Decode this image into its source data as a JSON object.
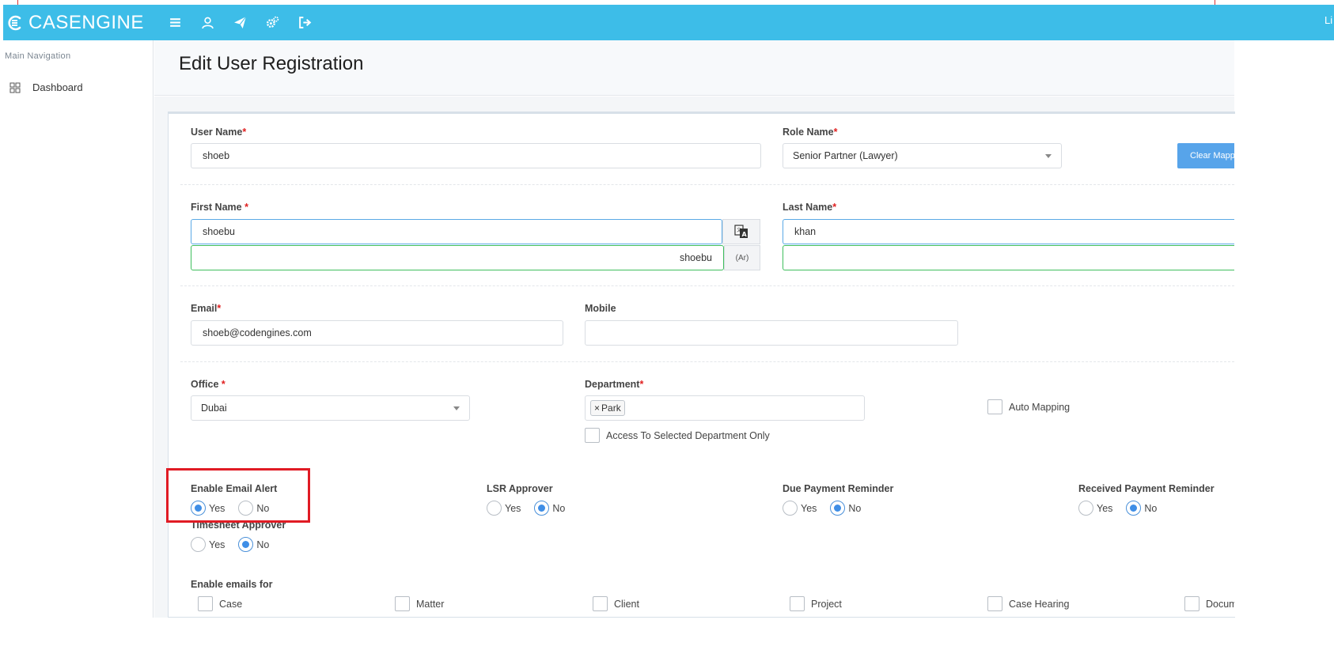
{
  "app": {
    "brand": "CASENGINE",
    "topbar_right_text": "Li"
  },
  "sidebar": {
    "heading": "Main Navigation",
    "items": [
      {
        "label": "Dashboard",
        "icon": "grid-icon"
      }
    ]
  },
  "page": {
    "title": "Edit User Registration"
  },
  "form": {
    "user_name": {
      "label": "User Name",
      "required": "*",
      "value": "shoeb"
    },
    "role_name": {
      "label": "Role Name",
      "required": "*",
      "value": "Senior Partner (Lawyer)"
    },
    "clear_mapping_label": "Clear Mapp",
    "first_name": {
      "label": "First Name ",
      "required": "*",
      "value": "shoebu",
      "value_ar": "shoebu",
      "ar_addon": "(Ar)"
    },
    "last_name": {
      "label": "Last Name",
      "required": "*",
      "value": "khan",
      "value_ar": ""
    },
    "email": {
      "label": "Email",
      "required": "*",
      "value": "shoeb@codengines.com"
    },
    "mobile": {
      "label": "Mobile",
      "value": ""
    },
    "office": {
      "label": "Office ",
      "required": "*",
      "value": "Dubai"
    },
    "department": {
      "label": "Department",
      "required": "*",
      "chips": [
        "Park"
      ],
      "chip_remove": "×"
    },
    "auto_mapping": {
      "label": "Auto Mapping",
      "checked": false
    },
    "access_selected_dept": {
      "label": "Access To Selected Department Only",
      "checked": false
    },
    "radio_groups": [
      {
        "label": "Enable Email Alert",
        "yes": "Yes",
        "no": "No",
        "selected": "yes"
      },
      {
        "label": "LSR Approver",
        "yes": "Yes",
        "no": "No",
        "selected": "no"
      },
      {
        "label": "Due Payment Reminder",
        "yes": "Yes",
        "no": "No",
        "selected": "no"
      },
      {
        "label": "Received Payment Reminder",
        "yes": "Yes",
        "no": "No",
        "selected": "no"
      },
      {
        "label": "Timesheet Approver",
        "yes": "Yes",
        "no": "No",
        "selected": "no"
      }
    ],
    "emails_for": {
      "label": "Enable emails for",
      "items": [
        "Case",
        "Matter",
        "Client",
        "Project",
        "Case Hearing",
        "Docume"
      ]
    }
  },
  "colors": {
    "topbar": "#3dbde8",
    "accent": "#3f8ee6",
    "highlight": "#e01b24",
    "required": "#e02020"
  }
}
